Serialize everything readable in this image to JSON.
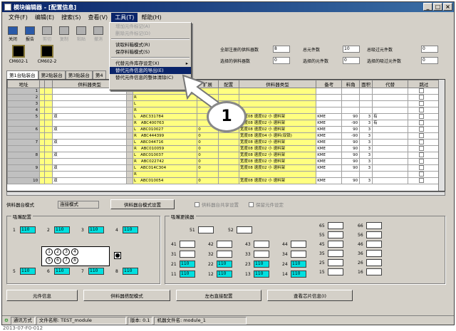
{
  "window": {
    "title": "模块编辑器 - [配置信息]",
    "min": "_",
    "max": "□",
    "close": "×"
  },
  "menu": [
    "文件(F)",
    "编辑(E)",
    "搜索(S)",
    "查看(V)",
    "工具(T)",
    "帮助(H)"
  ],
  "toolbar": [
    {
      "label": "关闭",
      "icon": "close-doc-icon",
      "enabled": true
    },
    {
      "label": "报告",
      "icon": "report-icon",
      "enabled": true
    },
    {
      "label": "剪切",
      "icon": "cut-icon",
      "enabled": false
    },
    {
      "label": "复制",
      "icon": "copy-icon",
      "enabled": false
    },
    {
      "label": "粘贴",
      "icon": "paste-icon",
      "enabled": false
    },
    {
      "label": "撤消",
      "icon": "undo-icon",
      "enabled": false
    }
  ],
  "dropdown": {
    "items": [
      {
        "label": "增加元件标记(A)",
        "state": "disabled"
      },
      {
        "label": "删除元件标记(D)",
        "state": "disabled"
      },
      {
        "label": "sep"
      },
      {
        "label": "读取料箱模式(R)",
        "state": "normal"
      },
      {
        "label": "保存料箱模式(S)",
        "state": "normal"
      },
      {
        "label": "sep"
      },
      {
        "label": "代替元件库存设定(X)",
        "state": "normal",
        "submenu": true
      },
      {
        "label": "替代元件信息的导出(E)",
        "state": "highlight"
      },
      {
        "label": "替代元件信息的整体清除(C)",
        "state": "normal"
      }
    ]
  },
  "modules": [
    {
      "label": "CM602-1"
    },
    {
      "label": "CM602-2"
    }
  ],
  "info": {
    "total_label": "全部注册的供料器数",
    "total_val": "8",
    "parts_label": "总元件数",
    "parts_val": "10",
    "mark_label": "总吸过元件数",
    "mark_val": "0",
    "sel_feeders_label": "选择的供料器数",
    "sel_feeders_val": "0",
    "sel_parts_label": "选择的元件数",
    "sel_parts_val": "0",
    "sel_mark_label": "选择的吸过元件数",
    "sel_mark_val": "0"
  },
  "tabs": [
    "第1台贴装台",
    "第2贴装台",
    "第3贴装台",
    "第4"
  ],
  "grid": {
    "headers": [
      "地址",
      "",
      "",
      "供料器类型",
      "",
      "元件名称",
      "扩展",
      "配置",
      "供料器类型",
      "备考",
      "料角",
      "面积",
      "代替",
      "跳过"
    ],
    "rows": [
      {
        "no": "1",
        "mark": "",
        "ft": "",
        "side": "L",
        "part": "",
        "ext": "",
        "ftype": "",
        "note": "",
        "a": "",
        "b": "",
        "alt": ""
      },
      {
        "no": "2",
        "mark": "",
        "ft": "",
        "side": "R",
        "part": "",
        "ext": "",
        "ftype": "",
        "note": "",
        "a": "",
        "b": "",
        "alt": ""
      },
      {
        "no": "3",
        "mark": "",
        "ft": "",
        "side": "L",
        "part": "",
        "ext": "",
        "ftype": "",
        "note": "",
        "a": "",
        "b": "",
        "alt": ""
      },
      {
        "no": "4",
        "mark": "",
        "ft": "",
        "side": "R",
        "part": "",
        "ext": "",
        "ftype": "",
        "note": "",
        "a": "",
        "b": "",
        "alt": ""
      },
      {
        "no": "5",
        "mark": "双",
        "ft": "",
        "side": "L",
        "part": "ABC331784",
        "ext": "",
        "ftype": "宽度08 速度02 小 速料架",
        "note": "KME",
        "a": "90",
        "b": "3",
        "alt": "有"
      },
      {
        "no": "",
        "mark": "",
        "ft": "",
        "side": "R",
        "part": "ABC400763",
        "ext": "",
        "ftype": "宽度08 速度02 小 速料架",
        "note": "KME",
        "a": "-90",
        "b": "3",
        "alt": "有"
      },
      {
        "no": "6",
        "mark": "双",
        "ft": "",
        "side": "L",
        "part": "ABC010027",
        "ext": "0",
        "ftype": "宽度08 速度02 小 速料架",
        "note": "KME",
        "a": "90",
        "b": "3",
        "alt": ""
      },
      {
        "no": "",
        "mark": "",
        "ft": "",
        "side": "R",
        "part": "ABC444399",
        "ext": "0",
        "ftype": "宽度08 速度04 小 速料(双锁)",
        "note": "KME",
        "a": "-90",
        "b": "3",
        "alt": ""
      },
      {
        "no": "7",
        "mark": "双",
        "ft": "",
        "side": "L",
        "part": "ABC044716",
        "ext": "0",
        "ftype": "宽度08 速度02 小 速料架",
        "note": "KME",
        "a": "90",
        "b": "3",
        "alt": ""
      },
      {
        "no": "",
        "mark": "",
        "ft": "",
        "side": "R",
        "part": "ABC010059",
        "ext": "0",
        "ftype": "宽度08 速度02 小 速料架",
        "note": "KME",
        "a": "90",
        "b": "3",
        "alt": ""
      },
      {
        "no": "8",
        "mark": "双",
        "ft": "",
        "side": "L",
        "part": "ABC010037",
        "ext": "0",
        "ftype": "宽度08 速度02 小 速料架",
        "note": "KME",
        "a": "90",
        "b": "3",
        "alt": ""
      },
      {
        "no": "",
        "mark": "",
        "ft": "",
        "side": "R",
        "part": "ABC022742",
        "ext": "0",
        "ftype": "宽度08 速度02 小 速料架",
        "note": "KME",
        "a": "90",
        "b": "3",
        "alt": ""
      },
      {
        "no": "9",
        "mark": "双",
        "ft": "",
        "side": "L",
        "part": "ABC014C304",
        "ext": "0",
        "ftype": "宽度08 速度02 小 速料架",
        "note": "KME",
        "a": "90",
        "b": "3",
        "alt": ""
      },
      {
        "no": "",
        "mark": "",
        "ft": "",
        "side": "R",
        "part": "",
        "ext": "",
        "ftype": "",
        "note": "",
        "a": "",
        "b": "",
        "alt": ""
      },
      {
        "no": "10",
        "mark": "双",
        "ft": "",
        "side": "L",
        "part": "ABC010054",
        "ext": "0",
        "ftype": "宽度08 速度02 小 速料架",
        "note": "KME",
        "a": "90",
        "b": "3",
        "alt": ""
      }
    ]
  },
  "modebar": {
    "label": "供料器台模式",
    "value": "连接模式",
    "set_btn": "供料器台模式设置",
    "chk1": "供料器台共享设置",
    "chk2": "保留元件设定"
  },
  "nozzle": {
    "title": "吸嘴配置",
    "slots": [
      {
        "n": "1",
        "v": "110"
      },
      {
        "n": "2",
        "v": "110"
      },
      {
        "n": "3",
        "v": "110"
      },
      {
        "n": "4",
        "v": "110"
      },
      {
        "n": "5",
        "v": "110"
      },
      {
        "n": "6",
        "v": "110"
      },
      {
        "n": "7",
        "v": "110"
      },
      {
        "n": "8",
        "v": "110"
      }
    ],
    "pins": [
      "1",
      "2",
      "3",
      "4",
      "5",
      "6",
      "7",
      "8"
    ]
  },
  "station": {
    "title": "吸嘴更换器",
    "top": [
      "51",
      "52"
    ],
    "c1": [
      {
        "n": "41",
        "v": ""
      },
      {
        "n": "31",
        "v": ""
      },
      {
        "n": "21",
        "v": "110"
      },
      {
        "n": "11",
        "v": "110"
      }
    ],
    "c2": [
      {
        "n": "42",
        "v": ""
      },
      {
        "n": "32",
        "v": ""
      },
      {
        "n": "22",
        "v": "110"
      },
      {
        "n": "12",
        "v": "110"
      }
    ],
    "c3": [
      {
        "n": "43",
        "v": ""
      },
      {
        "n": "33",
        "v": ""
      },
      {
        "n": "23",
        "v": "110"
      },
      {
        "n": "13",
        "v": "110"
      }
    ],
    "c4": [
      {
        "n": "44",
        "v": ""
      },
      {
        "n": "34",
        "v": ""
      },
      {
        "n": "24",
        "v": "110"
      },
      {
        "n": "14",
        "v": "110"
      }
    ],
    "c5": [
      {
        "n": "65",
        "v": ""
      },
      {
        "n": "55",
        "v": ""
      },
      {
        "n": "45",
        "v": ""
      },
      {
        "n": "35",
        "v": ""
      },
      {
        "n": "25",
        "v": ""
      },
      {
        "n": "15",
        "v": ""
      }
    ],
    "c6": [
      {
        "n": "66",
        "v": ""
      },
      {
        "n": "56",
        "v": ""
      },
      {
        "n": "46",
        "v": ""
      },
      {
        "n": "36",
        "v": ""
      },
      {
        "n": "26",
        "v": ""
      },
      {
        "n": "16",
        "v": ""
      }
    ]
  },
  "bottom_buttons": [
    "元件信息",
    "供料器搭配模式",
    "左右直接配置",
    "查看芯片信息(I)"
  ],
  "status": {
    "mode": "通讯方式",
    "file_label": "文件名称",
    "file": "TEST_module",
    "ver_label": "版本",
    "ver": "0.1",
    "machine_label": "机器文件名",
    "machine": "module_1"
  },
  "callout": "1",
  "caption": "2013-07-F0-012"
}
